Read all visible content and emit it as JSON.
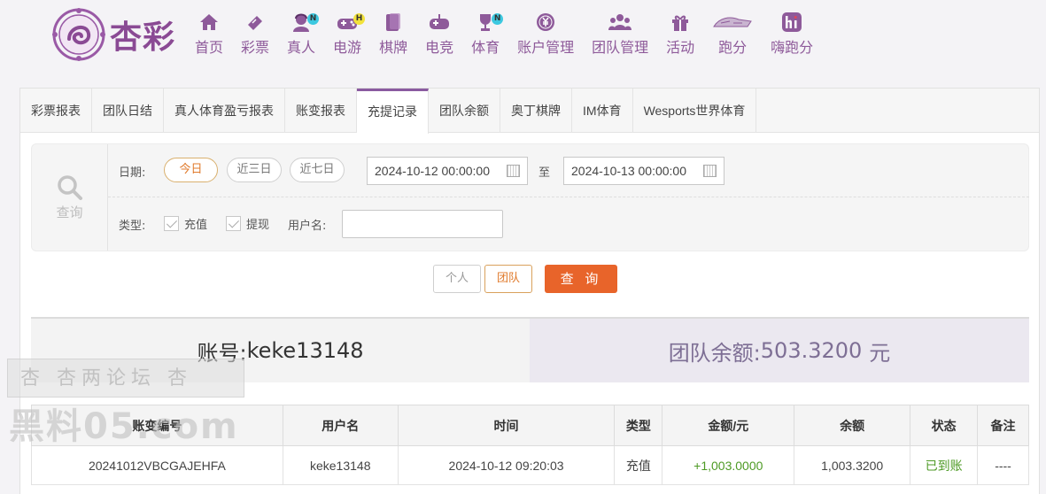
{
  "brand": {
    "logo_text": "杏彩"
  },
  "nav": [
    {
      "label": "首页",
      "icon": "home-icon"
    },
    {
      "label": "彩票",
      "icon": "ticket-icon"
    },
    {
      "label": "真人",
      "icon": "dealer-icon",
      "badge": "N",
      "badge_color": "#3cc8e0"
    },
    {
      "label": "电游",
      "icon": "gamepad-icon",
      "badge": "H",
      "badge_color": "#f2e23a"
    },
    {
      "label": "棋牌",
      "icon": "cards-icon"
    },
    {
      "label": "电竞",
      "icon": "controller-icon"
    },
    {
      "label": "体育",
      "icon": "trophy-icon",
      "badge": "N",
      "badge_color": "#3cc8e0"
    },
    {
      "label": "账户管理",
      "icon": "yen-coin-icon"
    },
    {
      "label": "团队管理",
      "icon": "team-icon"
    },
    {
      "label": "活动",
      "icon": "gift-icon"
    },
    {
      "label": "跑分",
      "icon": "run-score-icon"
    },
    {
      "label": "嗨跑分",
      "icon": "hi-app-icon"
    }
  ],
  "tabs": [
    {
      "label": "彩票报表",
      "active": false
    },
    {
      "label": "团队日结",
      "active": false
    },
    {
      "label": "真人体育盈亏报表",
      "active": false
    },
    {
      "label": "账变报表",
      "active": false
    },
    {
      "label": "充提记录",
      "active": true
    },
    {
      "label": "团队余额",
      "active": false
    },
    {
      "label": "奥丁棋牌",
      "active": false
    },
    {
      "label": "IM体育",
      "active": false
    },
    {
      "label": "Wesports世界体育",
      "active": false
    }
  ],
  "filter": {
    "side_label": "查询",
    "date_label": "日期:",
    "quick_dates": [
      "今日",
      "近三日",
      "近七日"
    ],
    "start_date": "2024-10-12 00:00:00",
    "to_label": "至",
    "end_date": "2024-10-13 00:00:00",
    "type_label": "类型:",
    "type_recharge": "充值",
    "type_withdraw": "提现",
    "username_label": "用户名:",
    "username_value": ""
  },
  "actions": {
    "personal": "个人",
    "team": "团队",
    "query": "查 询"
  },
  "summary": {
    "account_label": "账号:",
    "account": "keke13148",
    "balance_label": "团队余额:",
    "balance": "503.3200",
    "unit": "元"
  },
  "table": {
    "headers": [
      "账变编号",
      "用户名",
      "时间",
      "类型",
      "金额/元",
      "余额",
      "状态",
      "备注"
    ],
    "rows": [
      [
        "20241012VBCGAJEHFA",
        "keke13148",
        "2024-10-12 09:20:03",
        "充值",
        "+1,003.0000",
        "1,003.3200",
        "已到账",
        "----"
      ]
    ]
  },
  "watermark": {
    "line1": "杏 杏两论坛 杏",
    "line2": "黑料05.com"
  }
}
